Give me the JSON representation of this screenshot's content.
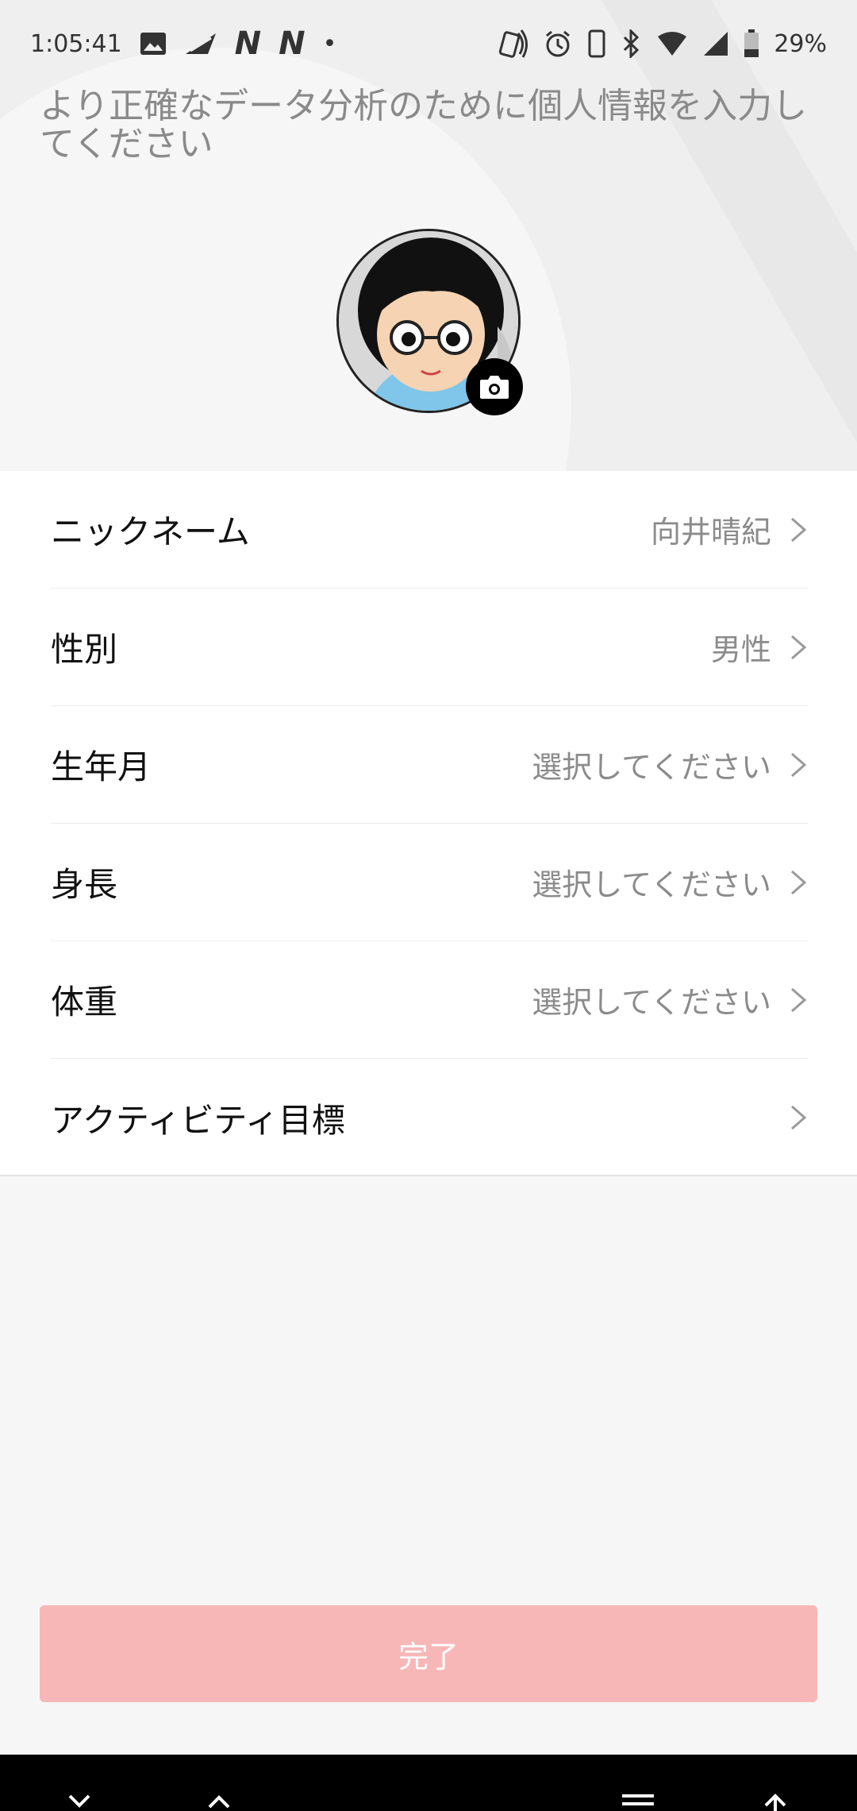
{
  "status_bar": {
    "time": "1:05:41",
    "notif_n1": "N",
    "notif_n2": "N",
    "dot": "•",
    "battery": "29%"
  },
  "header": {
    "subtitle": "より正確なデータ分析のために個人情報を入力してください"
  },
  "profile": {
    "rows": [
      {
        "label": "ニックネーム",
        "value": "向井晴紀"
      },
      {
        "label": "性別",
        "value": "男性"
      },
      {
        "label": "生年月",
        "value": "選択してください"
      },
      {
        "label": "身長",
        "value": "選択してください"
      },
      {
        "label": "体重",
        "value": "選択してください"
      },
      {
        "label": "アクティビティ目標",
        "value": ""
      }
    ]
  },
  "done_label": "完了",
  "colors": {
    "done_button_bg": "#f8b7b7",
    "avatar_shirt": "#7fc6ea",
    "background": "#f6f6f6"
  }
}
